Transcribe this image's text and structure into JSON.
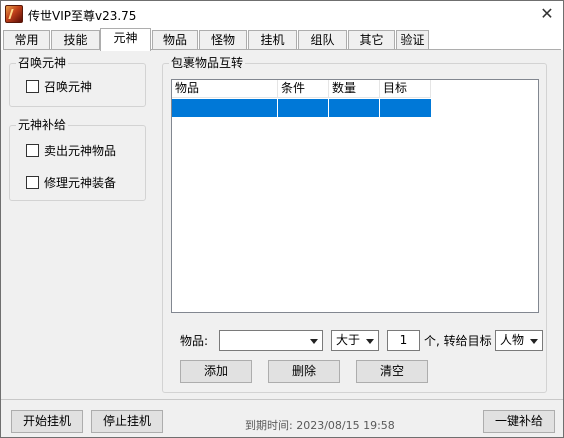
{
  "window": {
    "title": "传世VIP至尊v23.75",
    "close_glyph": "✕"
  },
  "tabs": [
    {
      "label": "常用"
    },
    {
      "label": "技能"
    },
    {
      "label": "元神",
      "active": true
    },
    {
      "label": "物品"
    },
    {
      "label": "怪物"
    },
    {
      "label": "挂机"
    },
    {
      "label": "组队"
    },
    {
      "label": "其它"
    },
    {
      "label": "验证"
    }
  ],
  "summon_group": {
    "title": "召唤元神",
    "checkbox_label": "召唤元神",
    "checked": false
  },
  "supply_group": {
    "title": "元神补给",
    "sell_label": "卖出元神物品",
    "sell_checked": false,
    "repair_label": "修理元神装备",
    "repair_checked": false
  },
  "transfer_group": {
    "title": "包裹物品互转",
    "columns": [
      "物品",
      "条件",
      "数量",
      "目标"
    ],
    "selected_row_count": 1,
    "item_label": "物品:",
    "item_value": "",
    "condition_value": "大于",
    "quantity_value": "1",
    "target_label": "个, 转给目标",
    "target_value": "人物",
    "add_button": "添加",
    "delete_button": "删除",
    "clear_button": "清空"
  },
  "footer": {
    "start_button": "开始挂机",
    "stop_button": "停止挂机",
    "expire_text": "到期时间: 2023/08/15 19:58",
    "supply_button": "一键补给"
  },
  "colors": {
    "selection": "#0078d7",
    "window_bg": "#f0f0f0"
  }
}
